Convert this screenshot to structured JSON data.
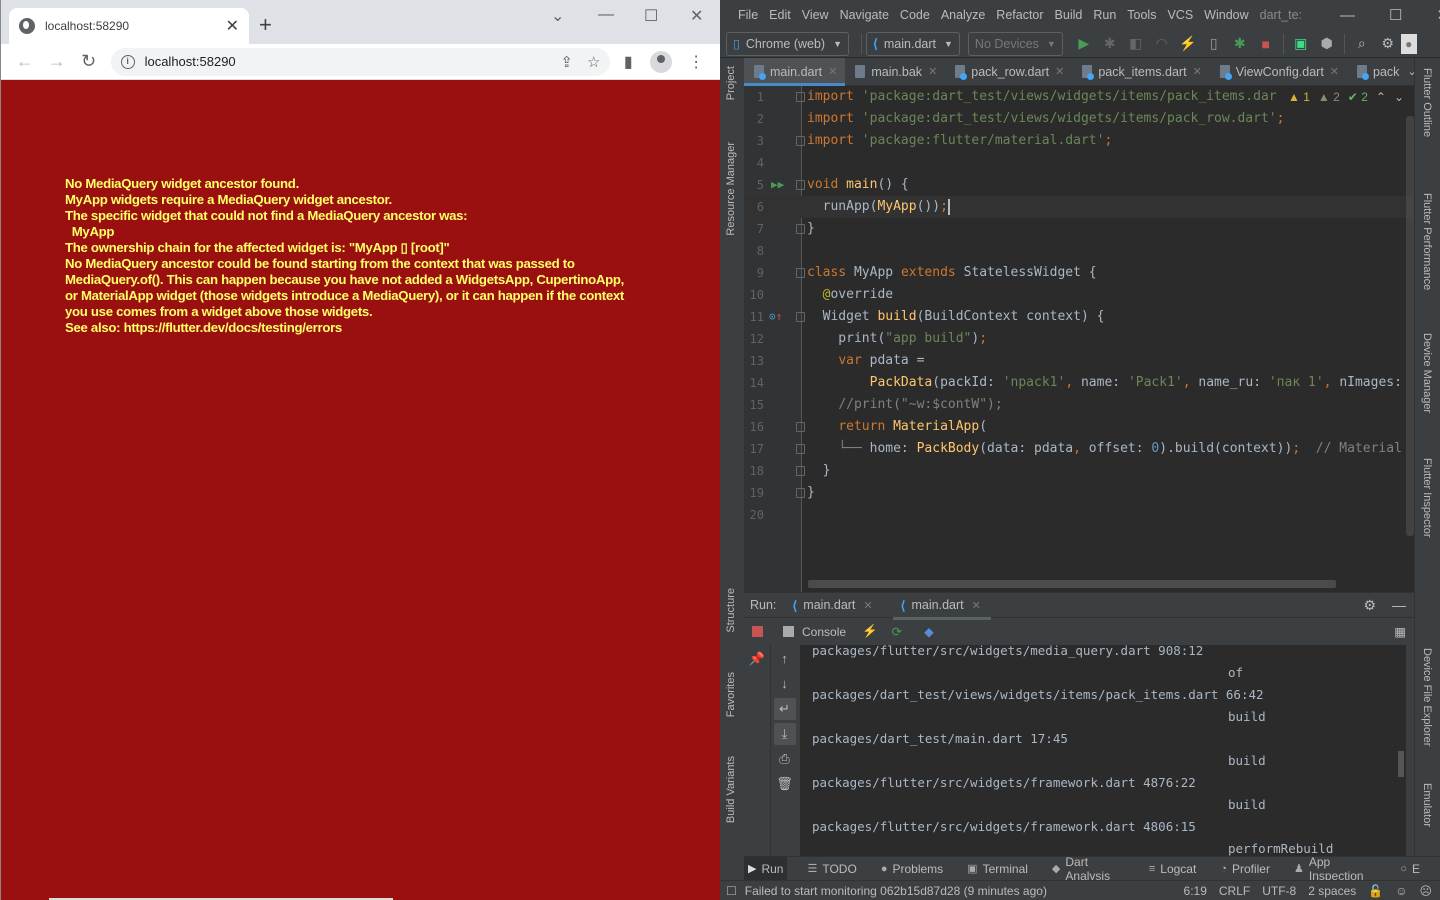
{
  "browser": {
    "tab_title": "localhost:58290",
    "url": "localhost:58290",
    "error_lines": [
      "No MediaQuery widget ancestor found.",
      "MyApp widgets require a MediaQuery widget ancestor.",
      "The specific widget that could not find a MediaQuery ancestor was:",
      "  MyApp",
      "The ownership chain for the affected widget is: \"MyApp ▯ [root]\"",
      "No MediaQuery ancestor could be found starting from the context that was passed to",
      "MediaQuery.of(). This can happen because you have not added a WidgetsApp, CupertinoApp,",
      "or MaterialApp widget (those widgets introduce a MediaQuery), or it can happen if the context",
      "you use comes from a widget above those widgets.",
      "See also: https://flutter.dev/docs/testing/errors"
    ],
    "background_color": "#9a1010",
    "error_text_color": "#ffff66"
  },
  "ide": {
    "menu": [
      "File",
      "Edit",
      "View",
      "Navigate",
      "Code",
      "Analyze",
      "Refactor",
      "Build",
      "Run",
      "Tools",
      "VCS",
      "Window"
    ],
    "project_name": "dart_te:",
    "device_combo": "Chrome (web)",
    "run_config": "main.dart",
    "devices_combo": "No Devices",
    "editor_tabs": [
      {
        "label": "main.dart",
        "active": true,
        "type": "dart"
      },
      {
        "label": "main.bak",
        "active": false,
        "type": "text"
      },
      {
        "label": "pack_row.dart",
        "active": false,
        "type": "dart"
      },
      {
        "label": "pack_items.dart",
        "active": false,
        "type": "dart"
      },
      {
        "label": "ViewConfig.dart",
        "active": false,
        "type": "dart"
      },
      {
        "label": "pack",
        "active": false,
        "type": "dart"
      }
    ],
    "left_strip": [
      "Project",
      "Resource Manager",
      "Structure",
      "Favorites",
      "Build Variants"
    ],
    "right_strip": [
      "Flutter Outline",
      "Flutter Performance",
      "Device Manager",
      "Flutter Inspector",
      "Device File Explorer",
      "Emulator"
    ],
    "inspections": {
      "warnings": "1",
      "weak_warnings": "2",
      "typos": "2"
    },
    "code_lines": [
      {
        "n": "1",
        "html": "<span class='kw'>import </span><span class='str'>'package:dart_test/views/widgets/items/pack_items.dar</span>"
      },
      {
        "n": "2",
        "html": "<span class='kw'>import </span><span class='str'>'package:dart_test/views/widgets/items/pack_row.dart'</span><span class='kw'>;</span>"
      },
      {
        "n": "3",
        "html": "<span class='kw'>import </span><span class='str'>'package:flutter/material.dart'</span><span class='kw'>;</span>"
      },
      {
        "n": "4",
        "html": ""
      },
      {
        "n": "5",
        "html": "<span class='kw'>void </span><span class='fn'>main</span>() {"
      },
      {
        "n": "6",
        "html": "  runApp(<span class='fn'>MyApp</span>())<span class='kw'>;</span><span class='caret'></span>"
      },
      {
        "n": "7",
        "html": "}"
      },
      {
        "n": "8",
        "html": ""
      },
      {
        "n": "9",
        "html": "<span class='kw'>class </span>MyApp <span class='kw'>extends </span>StatelessWidget {"
      },
      {
        "n": "10",
        "html": "  <span class='ann'>@</span>override"
      },
      {
        "n": "11",
        "html": "  Widget <span class='fn'>build</span>(BuildContext context) {"
      },
      {
        "n": "12",
        "html": "    print(<span class='str'>\"app build\"</span>)<span class='kw'>;</span>"
      },
      {
        "n": "13",
        "html": "    <span class='kw'>var </span>pdata ="
      },
      {
        "n": "14",
        "html": "        <span class='fn'>PackData</span>(packId: <span class='str'>'npack1'</span><span class='kw'>, </span>name: <span class='str'>'Pack1'</span><span class='kw'>, </span>name_ru: <span class='str'>'пак 1'</span><span class='kw'>, </span>nImages:"
      },
      {
        "n": "15",
        "html": "    <span class='cm'>//print(\"~w:$contW\");</span>"
      },
      {
        "n": "16",
        "html": "    <span class='kw'>return </span><span class='fn'>MaterialApp</span>("
      },
      {
        "n": "17",
        "html": "    <span class='cm'>└──</span> home: <span class='fn'>PackBody</span>(data: pdata<span class='kw'>, </span>offset: <span class='num'>0</span>).build(context))<span class='kw'>;</span>  <span class='cm'>// Material</span>"
      },
      {
        "n": "18",
        "html": "  }"
      },
      {
        "n": "19",
        "html": "}"
      },
      {
        "n": "20",
        "html": ""
      }
    ],
    "run_panel": {
      "label": "Run:",
      "tabs": [
        "main.dart",
        "main.dart"
      ],
      "console_label": "Console",
      "lines": [
        {
          "left": "packages/flutter/src/widgets/media_query.dart 908:12",
          "right": ""
        },
        {
          "left": "",
          "right": "of"
        },
        {
          "left": "packages/dart_test/views/widgets/items/pack_items.dart 66:42",
          "right": ""
        },
        {
          "left": "",
          "right": "build"
        },
        {
          "left": "packages/dart_test/main.dart 17:45",
          "right": ""
        },
        {
          "left": "",
          "right": "build"
        },
        {
          "left": "packages/flutter/src/widgets/framework.dart 4876:22",
          "right": ""
        },
        {
          "left": "",
          "right": "build"
        },
        {
          "left": "packages/flutter/src/widgets/framework.dart 4806:15",
          "right": ""
        },
        {
          "left": "",
          "right": "performRebuild"
        }
      ]
    },
    "bottom_tabs": [
      {
        "icon": "▶",
        "label": "Run"
      },
      {
        "icon": "☰",
        "label": "TODO"
      },
      {
        "icon": "●",
        "label": "Problems"
      },
      {
        "icon": "▣",
        "label": "Terminal"
      },
      {
        "icon": "◆",
        "label": "Dart Analysis"
      },
      {
        "icon": "≡",
        "label": "Logcat"
      },
      {
        "icon": "◔",
        "label": "Profiler"
      },
      {
        "icon": "♟",
        "label": "App Inspection"
      },
      {
        "icon": "○",
        "label": "E"
      }
    ],
    "status": {
      "message": "Failed to start monitoring 062b15d87d28 (9 minutes ago)",
      "position": "6:19",
      "line_sep": "CRLF",
      "encoding": "UTF-8",
      "indent": "2 spaces"
    }
  }
}
